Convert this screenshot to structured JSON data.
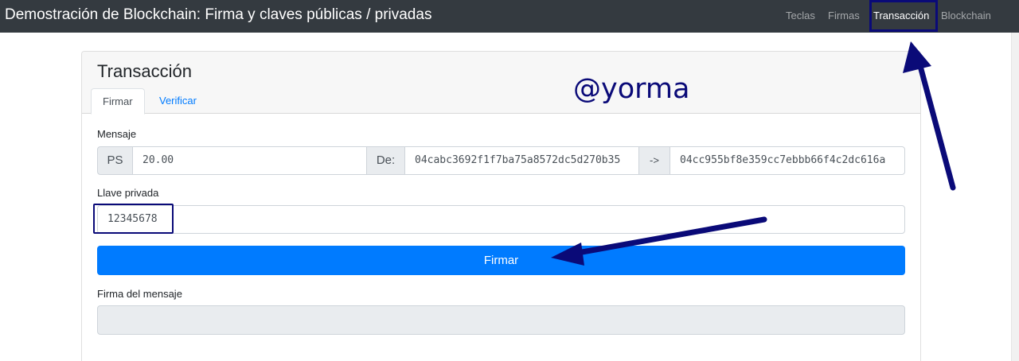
{
  "navbar": {
    "brand": "Demostración de Blockchain: Firma y claves públicas / privadas",
    "links": [
      {
        "label": "Teclas",
        "active": false
      },
      {
        "label": "Firmas",
        "active": false
      },
      {
        "label": "Transacción",
        "active": true
      },
      {
        "label": "Blockchain",
        "active": false
      }
    ]
  },
  "card": {
    "title": "Transacción",
    "tabs": [
      {
        "label": "Firmar",
        "active": true
      },
      {
        "label": "Verificar",
        "active": false
      }
    ]
  },
  "watermark": "@yorma",
  "form": {
    "message_label": "Mensaje",
    "amount_addon": "PS",
    "amount_value": "20.00",
    "from_addon": "De:",
    "from_value": "04cabc3692f1f7ba75a8572dc5d270b35",
    "arrow_addon": "->",
    "to_value": "04cc955bf8e359cc7ebbb66f4c2dc616a",
    "privkey_label": "Llave privada",
    "privkey_value": "12345678",
    "sign_button": "Firmar",
    "signature_label": "Firma del mensaje",
    "signature_value": ""
  },
  "colors": {
    "navbar_bg": "#343a40",
    "primary": "#007bff",
    "annotation": "#0a0a78",
    "addon_bg": "#e9ecef"
  }
}
